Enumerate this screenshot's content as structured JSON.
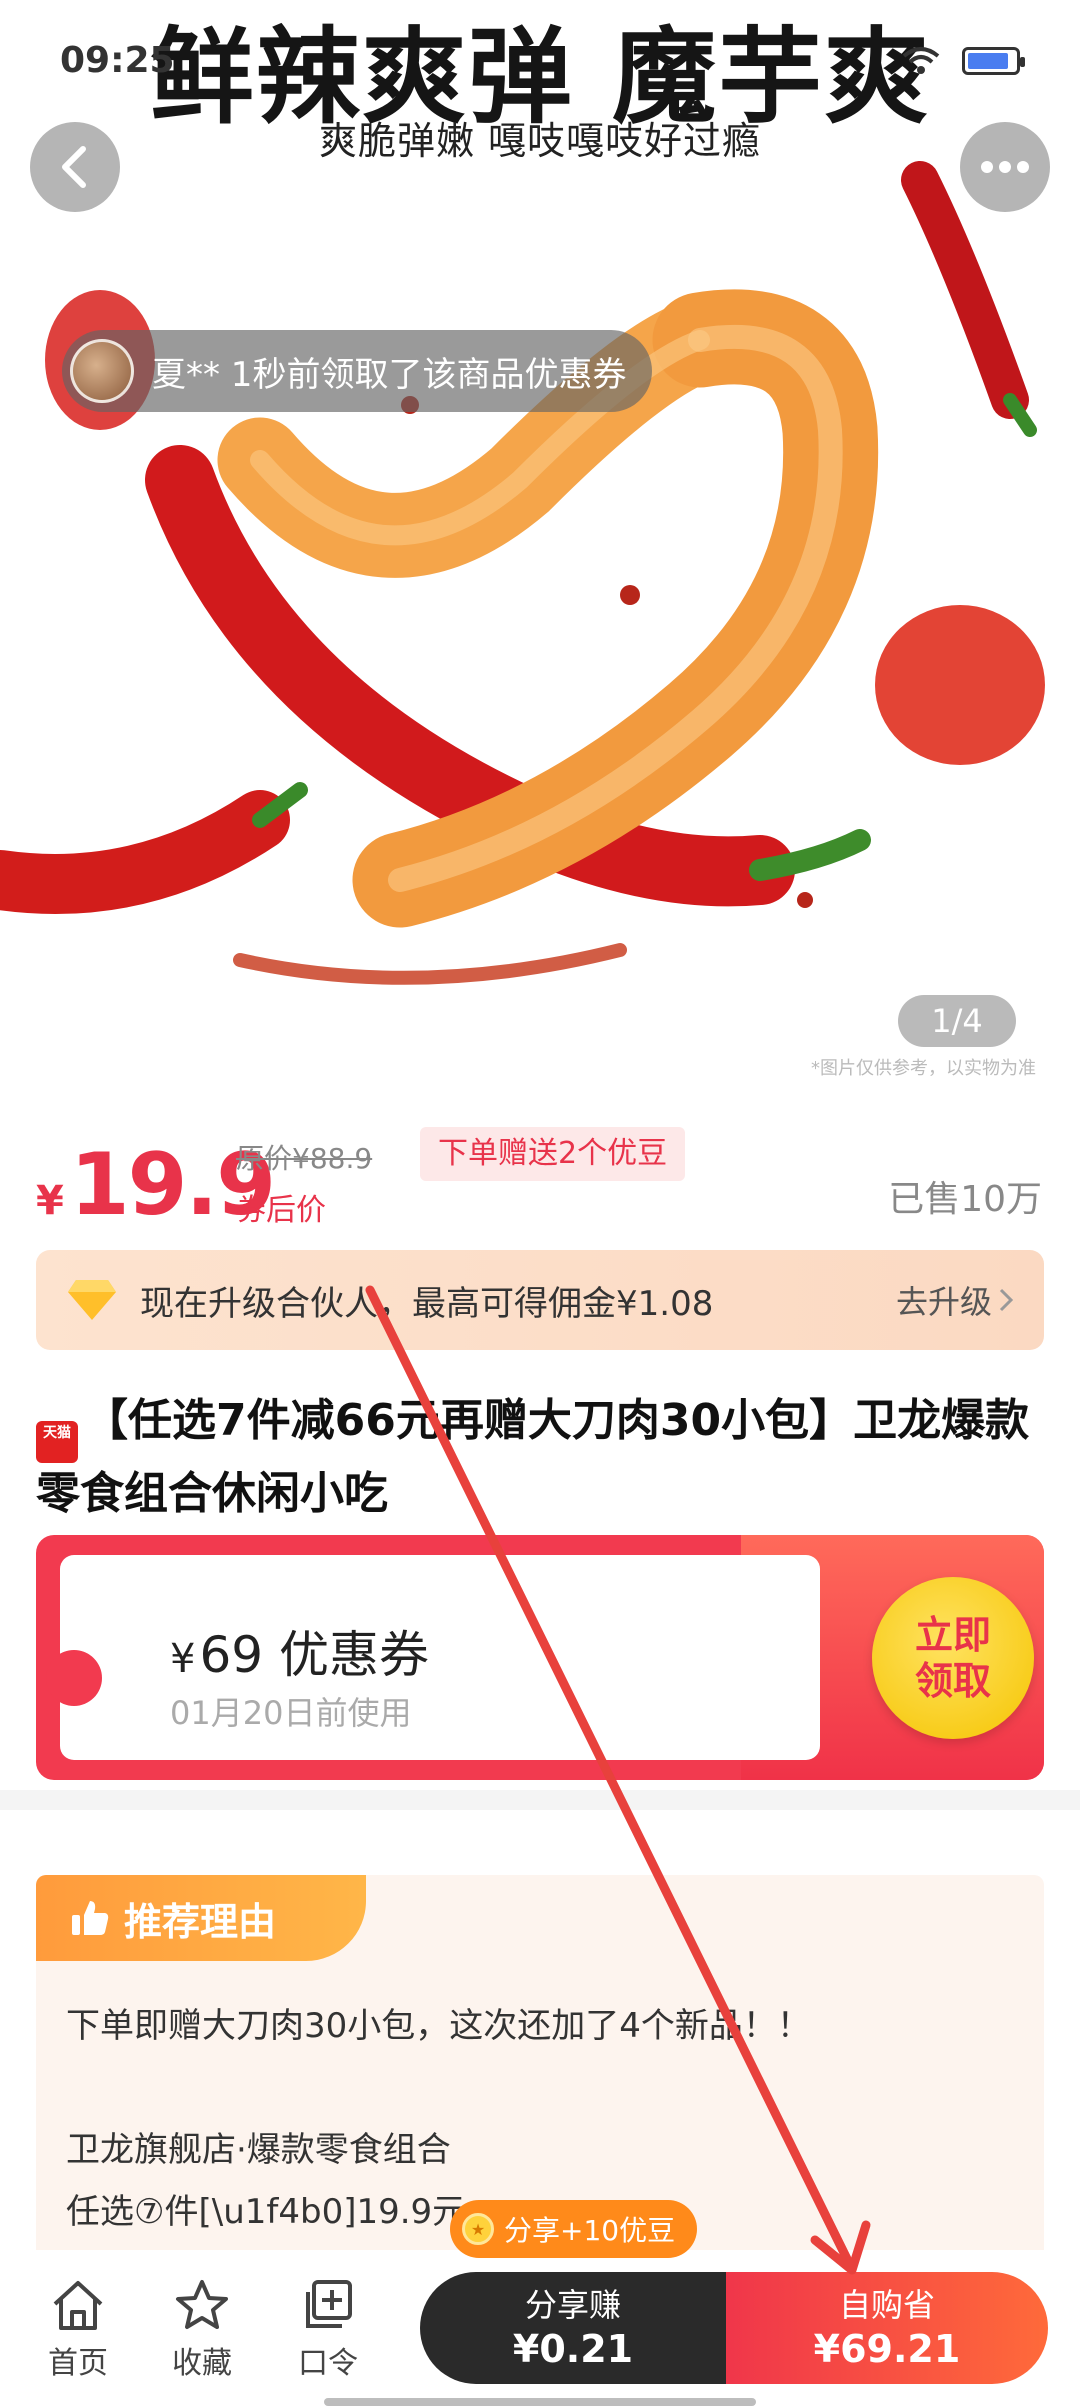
{
  "status_bar": {
    "time": "09:25"
  },
  "hero": {
    "title": "鲜辣爽弹 魔芋爽",
    "subtitle": "爽脆弹嫩 嘎吱嘎吱好过瘾",
    "notify": "夏** 1秒前领取了该商品优惠券",
    "counter": "1/4",
    "disclaimer": "*图片仅供参考，以实物为准"
  },
  "price": {
    "currency": "¥",
    "value": "19.9",
    "original": "原价¥88.9",
    "after_coupon": "券后价",
    "bonus_tag": "下单赠送2个优豆",
    "sold": "已售10万"
  },
  "upgrade": {
    "text": "现在升级合伙人，最高可得佣金¥1.08",
    "link": "去升级"
  },
  "product": {
    "badge": "天猫",
    "title": "【任选7件减66元再赠大刀肉30小包】卫龙爆款零食组合休闲小吃"
  },
  "coupon": {
    "currency": "¥",
    "amount": "69",
    "label": "优惠券",
    "expire": "01月20日前使用",
    "claim_line1": "立即",
    "claim_line2": "领取"
  },
  "recommend": {
    "tag": "推荐理由",
    "line1": "下单即赠大刀肉30小包，这次还加了4个新品！！",
    "line2": "卫龙旗舰店·爆款零食组合",
    "line3": "任选⑦件[\\u1f4b0]19.9元"
  },
  "share_pill": "分享+10优豆",
  "bottom_nav": {
    "home": "首页",
    "favorite": "收藏",
    "command": "口令",
    "share_label": "分享赚",
    "share_amount": "¥0.21",
    "buy_label": "自购省",
    "buy_amount": "¥69.21"
  },
  "colors": {
    "accent_red": "#e8334a",
    "orange": "#ff9b3c",
    "annotation_arrow": "#e8413c"
  }
}
